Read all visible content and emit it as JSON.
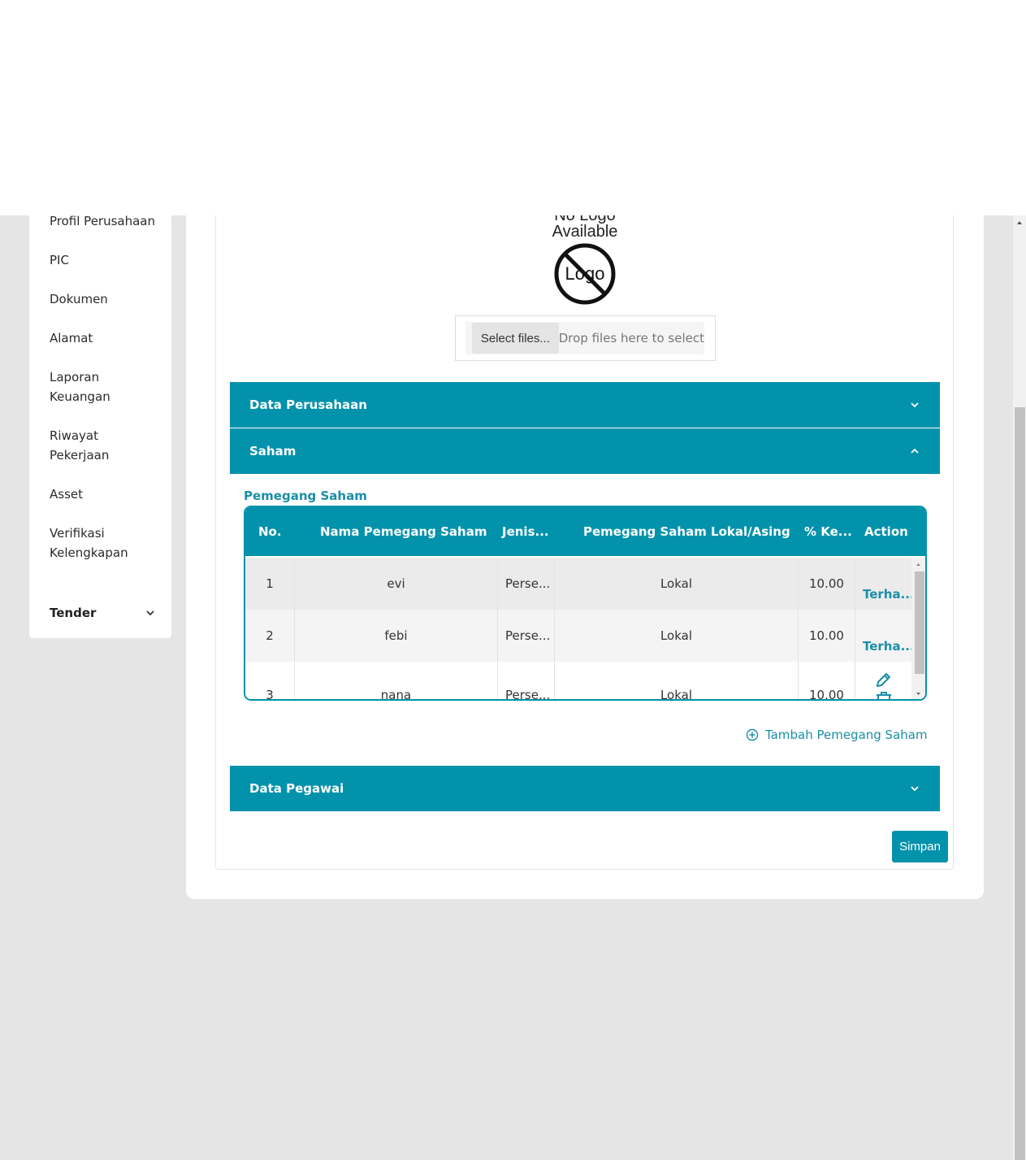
{
  "sidebar": {
    "items": [
      {
        "label": "Profil Perusahaan"
      },
      {
        "label": "PIC"
      },
      {
        "label": "Dokumen"
      },
      {
        "label": "Alamat"
      },
      {
        "label": "Laporan Keuangan"
      },
      {
        "label": "Riwayat Pekerjaan"
      },
      {
        "label": "Asset"
      },
      {
        "label": "Verifikasi Kelengkapan"
      }
    ],
    "tender": {
      "label": "Tender"
    }
  },
  "logo": {
    "line1": "No Logo",
    "line2": "Available",
    "inner": "Logo"
  },
  "upload": {
    "button": "Select files...",
    "drop": "Drop files here to select"
  },
  "panels": {
    "data_perusahaan": "Data Perusahaan",
    "saham": "Saham",
    "data_pegawai": "Data Pegawai"
  },
  "pemegang": {
    "title": "Pemegang Saham",
    "columns": [
      "No.",
      "Nama Pemegang Saham",
      "Jenis...",
      "Pemegang Saham Lokal/Asing",
      "% Ke...",
      "Action"
    ],
    "rows": [
      {
        "no": "1",
        "nama": "evi",
        "jenis": "Perse...",
        "lokal": "Lokal",
        "persen": "10.00",
        "action": "Terha..."
      },
      {
        "no": "2",
        "nama": "febi",
        "jenis": "Perse...",
        "lokal": "Lokal",
        "persen": "10.00",
        "action": "Terha..."
      },
      {
        "no": "3",
        "nama": "nana",
        "jenis": "Perse...",
        "lokal": "Lokal",
        "persen": "10.00",
        "action": ""
      }
    ],
    "add_label": "Tambah Pemegang Saham"
  },
  "footer": {
    "save_label": "Simpan"
  },
  "colors": {
    "accent": "#0392ab",
    "link": "#1a8fa6",
    "background": "#e5e5e5"
  }
}
